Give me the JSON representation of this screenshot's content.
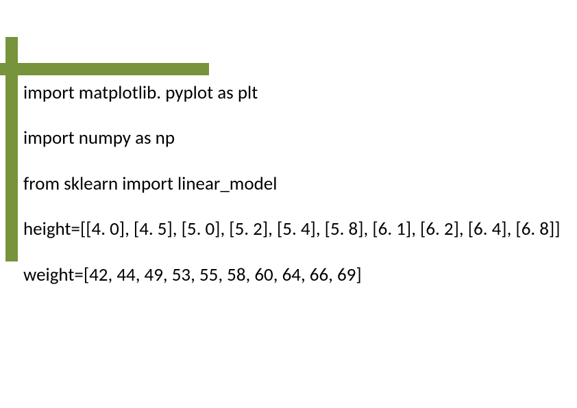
{
  "code": {
    "line1": "import matplotlib. pyplot as plt",
    "line2": "import numpy as np",
    "line3": "from sklearn import linear_model",
    "line4": "height=[[4. 0], [4. 5], [5. 0], [5. 2], [5. 4], [5. 8], [6. 1], [6. 2], [6. 4], [6. 8]]",
    "line5": "weight=[42, 44, 49, 53, 55, 58, 60, 64, 66, 69]"
  },
  "frame_color": "#77933c"
}
